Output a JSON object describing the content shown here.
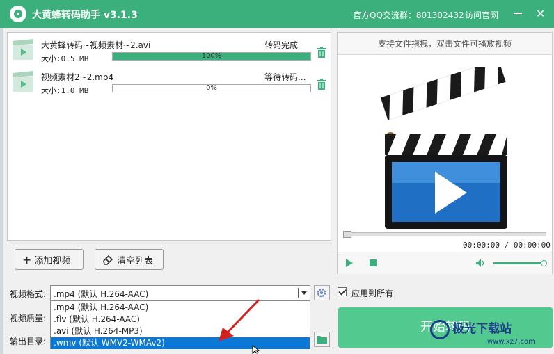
{
  "titlebar": {
    "title": "大黄蜂转码助手 v3.1.3",
    "qq_group": "官方QQ交流群：801302432",
    "visit_site": "访问官网",
    "close": "✕"
  },
  "files": [
    {
      "name": "大黄蜂转码~视频素材~2.avi",
      "size": "大小:0.5 MB",
      "status": "转码完成",
      "progress": 100,
      "progress_label": "100%"
    },
    {
      "name": "视频素材2~2.mp4",
      "size": "大小:1.0 MB",
      "status": "等待转码...",
      "progress": 0,
      "progress_label": "0%"
    }
  ],
  "buttons": {
    "add_video": "添加视频",
    "add_icon": "+",
    "clear_list": "清空列表",
    "start": "开始转码"
  },
  "preview": {
    "hint": "支持文件拖拽，双击文件可播放视频",
    "time": "00:00:00 / 00:00:00",
    "volume": 0.95
  },
  "settings": {
    "format_label": "视频格式:",
    "quality_label": "视频质量:",
    "output_label": "输出目录:",
    "format_value": ".mp4 (默认 H.264-AAC)",
    "apply_all": "应用到所有",
    "format_options": [
      ".mp4 (默认 H.264-AAC)",
      ".flv (默认 H.264-AAC)",
      ".avi (默认 H.264-MP3)",
      ".wmv (默认 WMV2-WMAv2)"
    ]
  },
  "watermark": {
    "text": "极光下载站",
    "url": "www.xz7.com"
  },
  "colors": {
    "accent": "#3cb07c",
    "start_button": "#52c98f",
    "selection": "#0a78d7",
    "annotation_arrow": "#d62020"
  }
}
